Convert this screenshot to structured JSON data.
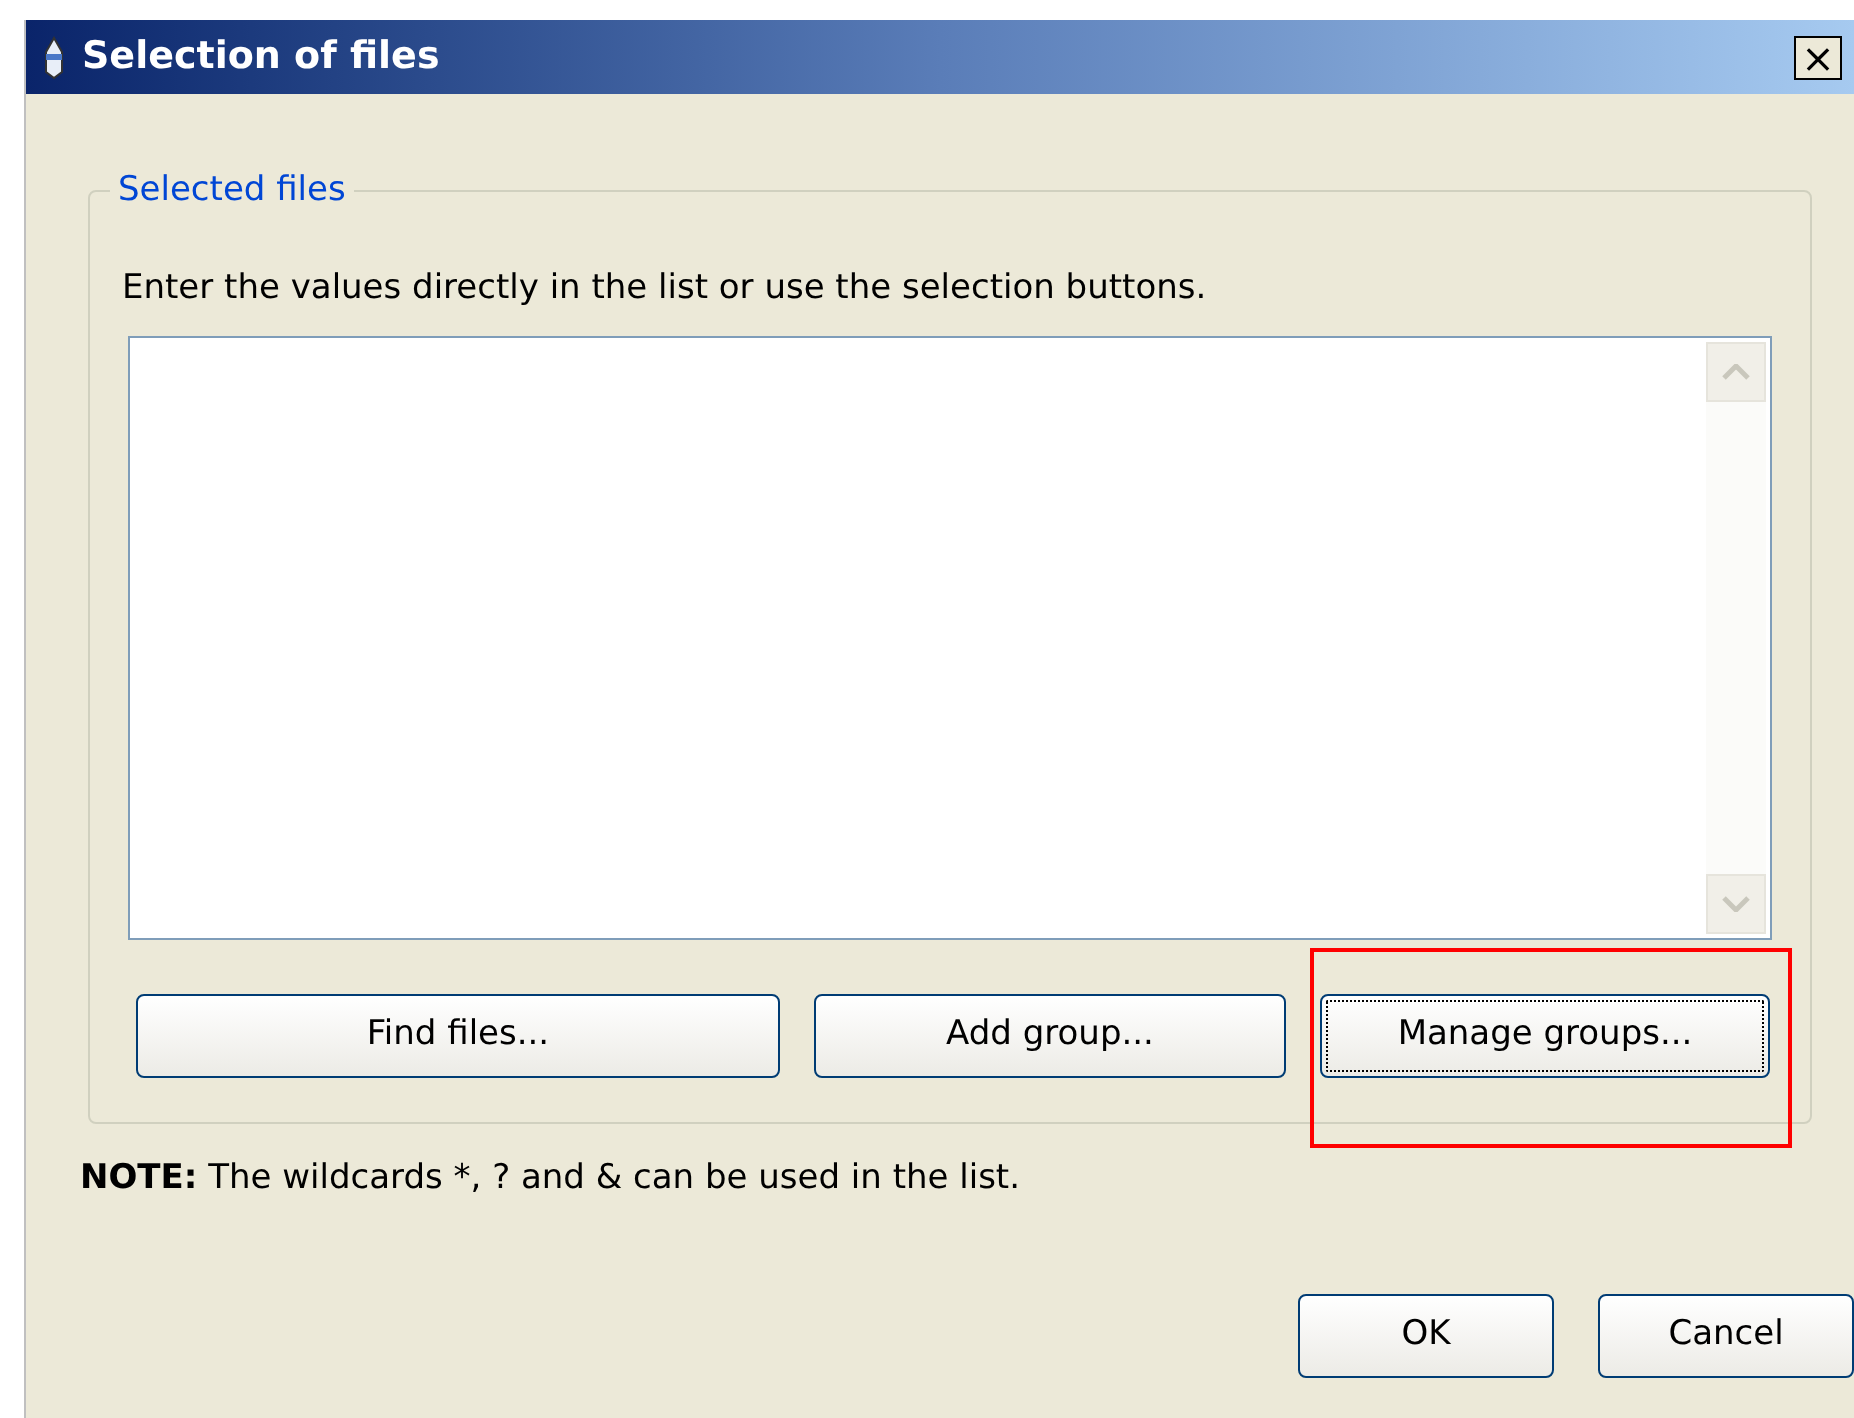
{
  "window": {
    "title": "Selection of files",
    "close": "×"
  },
  "group": {
    "legend": "Selected files",
    "instruction": "Enter the values directly in the list or use the selection buttons.",
    "buttons": [
      {
        "label": "Find files...",
        "focused": false,
        "highlighted": false
      },
      {
        "label": "Add group...",
        "focused": false,
        "highlighted": false
      },
      {
        "label": "Manage groups...",
        "focused": true,
        "highlighted": true
      }
    ]
  },
  "note": "**NOTE:** The wildcards *, ? and & can be used in the list.",
  "buttons": [
    "OK",
    "Cancel"
  ]
}
